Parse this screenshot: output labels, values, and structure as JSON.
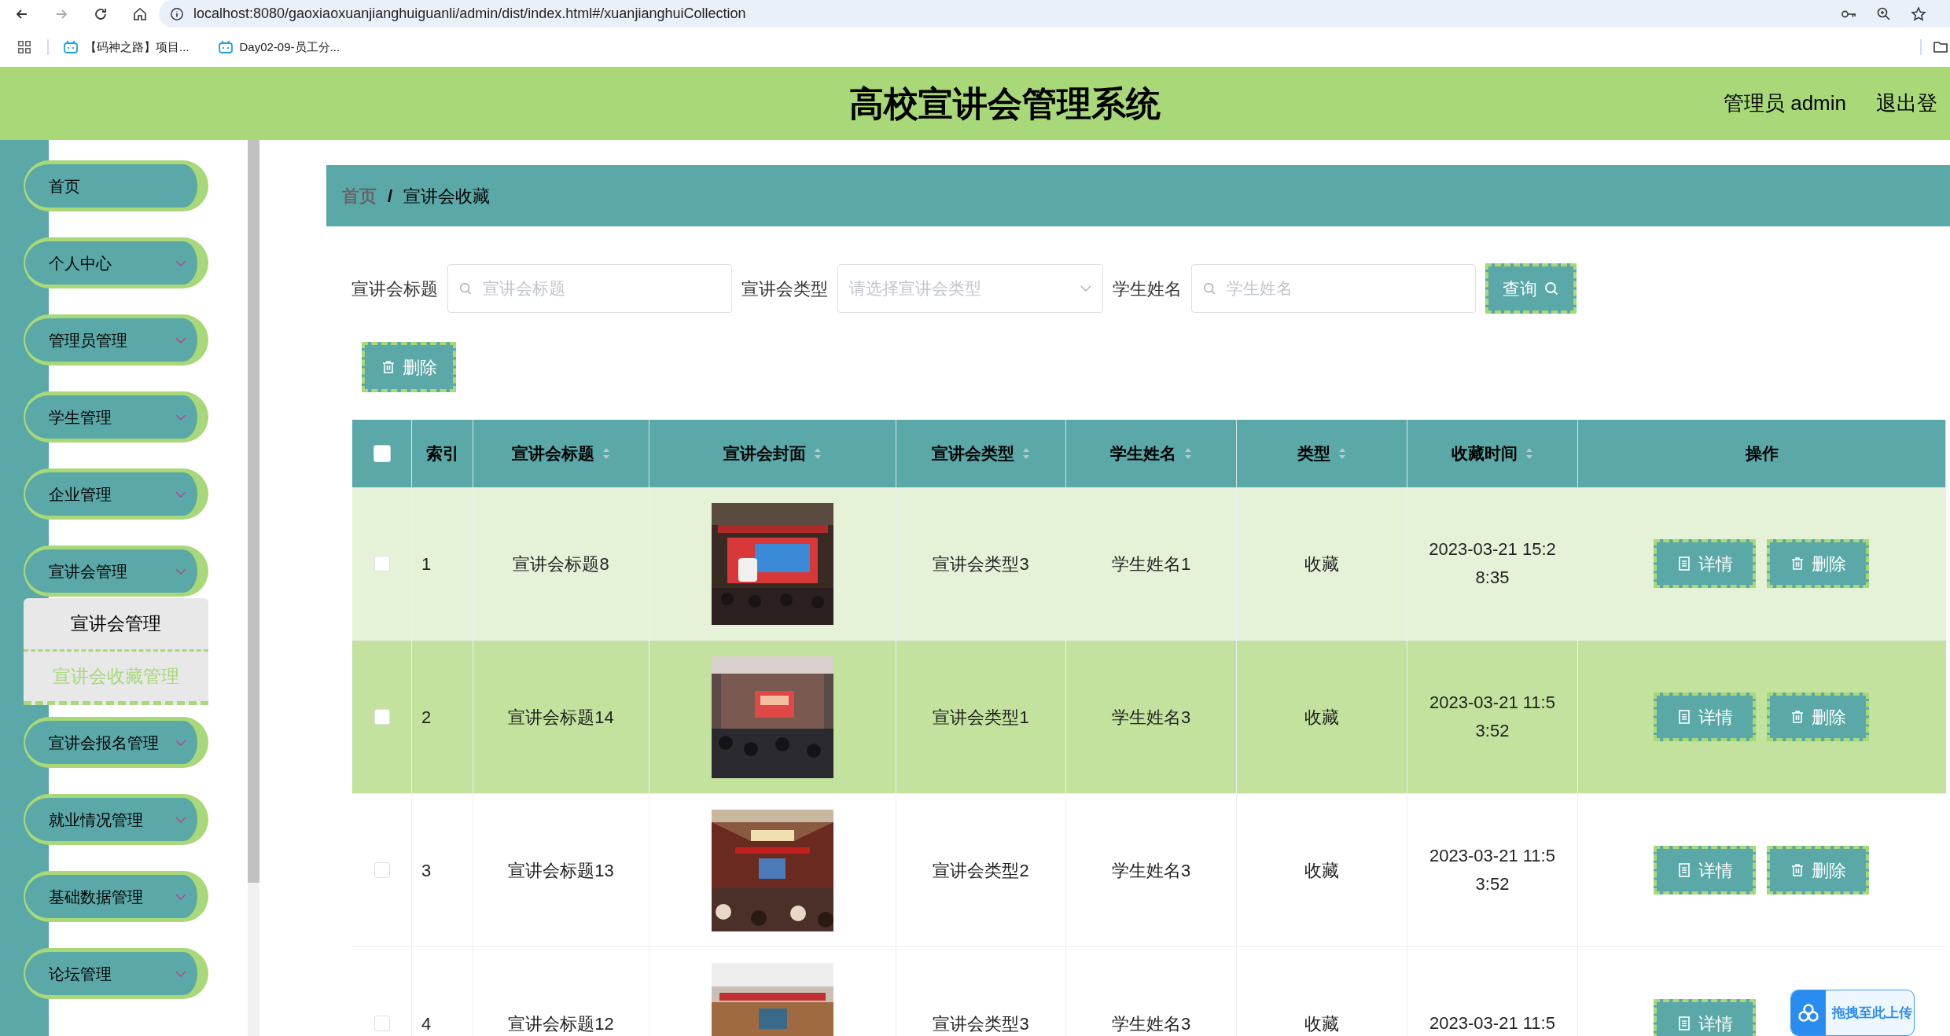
{
  "browser": {
    "url": "localhost:8080/gaoxiaoxuanjianghuiguanli/admin/dist/index.html#/xuanjianghuiCollection",
    "bookmarks": [
      "【码神之路】项目...",
      "Day02-09-员工分..."
    ]
  },
  "header": {
    "title": "高校宣讲会管理系统",
    "user": "管理员 admin",
    "logout": "退出登"
  },
  "sidebar": {
    "items": [
      {
        "label": "首页",
        "kind": "link"
      },
      {
        "label": "个人中心",
        "kind": "menu"
      },
      {
        "label": "管理员管理",
        "kind": "menu"
      },
      {
        "label": "学生管理",
        "kind": "menu"
      },
      {
        "label": "企业管理",
        "kind": "menu"
      },
      {
        "label": "宣讲会管理",
        "kind": "menu",
        "children": [
          {
            "label": "宣讲会管理",
            "selected": false
          },
          {
            "label": "宣讲会收藏管理",
            "selected": true
          }
        ]
      },
      {
        "label": "宣讲会报名管理",
        "kind": "menu"
      },
      {
        "label": "就业情况管理",
        "kind": "menu"
      },
      {
        "label": "基础数据管理",
        "kind": "menu"
      },
      {
        "label": "论坛管理",
        "kind": "menu"
      }
    ]
  },
  "breadcrumb": {
    "items": [
      "首页",
      "宣讲会收藏"
    ],
    "separator": "/"
  },
  "search": {
    "fields": [
      {
        "label": "宣讲会标题",
        "placeholder": "宣讲会标题",
        "kind": "text"
      },
      {
        "label": "宣讲会类型",
        "placeholder": "请选择宣讲会类型",
        "kind": "select"
      },
      {
        "label": "学生姓名",
        "placeholder": "学生姓名",
        "kind": "text"
      }
    ],
    "button": "查询"
  },
  "toolbar": {
    "delete": "删除"
  },
  "table": {
    "select_all": {
      "checked": false
    },
    "columns": [
      {
        "label": "索引",
        "sortable": false
      },
      {
        "label": "宣讲会标题",
        "sortable": true
      },
      {
        "label": "宣讲会封面",
        "sortable": true
      },
      {
        "label": "宣讲会类型",
        "sortable": true
      },
      {
        "label": "学生姓名",
        "sortable": true
      },
      {
        "label": "类型",
        "sortable": true
      },
      {
        "label": "收藏时间",
        "sortable": true
      },
      {
        "label": "操作",
        "sortable": false
      }
    ],
    "rows": [
      {
        "checked": false,
        "hovered": false,
        "index": "1",
        "title": "宣讲会标题8",
        "cover": {
          "kind": "picture"
        },
        "type": "宣讲会类型3",
        "student": "学生姓名1",
        "category": "收藏",
        "time": "2023-03-21 15:28:35",
        "actions": [
          "详情",
          "删除"
        ]
      },
      {
        "checked": false,
        "hovered": true,
        "index": "2",
        "title": "宣讲会标题14",
        "cover": {
          "kind": "picture"
        },
        "type": "宣讲会类型1",
        "student": "学生姓名3",
        "category": "收藏",
        "time": "2023-03-21 11:53:52",
        "actions": [
          "详情",
          "删除"
        ]
      },
      {
        "checked": false,
        "hovered": false,
        "index": "3",
        "title": "宣讲会标题13",
        "cover": {
          "kind": "picture"
        },
        "type": "宣讲会类型2",
        "student": "学生姓名3",
        "category": "收藏",
        "time": "2023-03-21 11:53:52",
        "actions": [
          "详情",
          "删除"
        ]
      },
      {
        "checked": false,
        "hovered": false,
        "index": "4",
        "title": "宣讲会标题12",
        "cover": {
          "kind": "picture"
        },
        "type": "宣讲会类型3",
        "student": "学生姓名3",
        "category": "收藏",
        "time": "2023-03-21 11:5",
        "actions": [
          "详情"
        ]
      }
    ]
  },
  "upload_widget": {
    "label": "拖拽至此上传"
  }
}
